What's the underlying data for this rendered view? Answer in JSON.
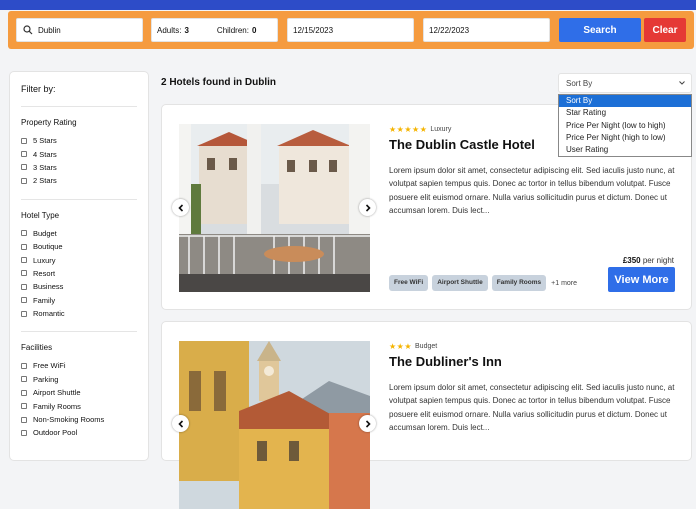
{
  "search": {
    "location": "Dublin",
    "adults_label": "Adults:",
    "adults_value": "3",
    "children_label": "Children:",
    "children_value": "0",
    "check_in": "12/15/2023",
    "check_out": "12/22/2023",
    "search_label": "Search",
    "clear_label": "Clear"
  },
  "filters": {
    "title": "Filter by:",
    "property_rating": {
      "heading": "Property Rating",
      "options": [
        "5 Stars",
        "4 Stars",
        "3 Stars",
        "2 Stars"
      ]
    },
    "hotel_type": {
      "heading": "Hotel Type",
      "options": [
        "Budget",
        "Boutique",
        "Luxury",
        "Resort",
        "Business",
        "Family",
        "Romantic"
      ]
    },
    "facilities": {
      "heading": "Facilities",
      "options": [
        "Free WiFi",
        "Parking",
        "Airport Shuttle",
        "Family Rooms",
        "Non-Smoking Rooms",
        "Outdoor Pool"
      ]
    }
  },
  "results": {
    "title": "2 Hotels found in Dublin"
  },
  "sort": {
    "current": "Sort By",
    "options": [
      "Sort By",
      "Star Rating",
      "Price Per Night (low to high)",
      "Price Per Night (high to low)",
      "User Rating"
    ]
  },
  "hotels": [
    {
      "stars": "★★★★★",
      "category": "Luxury",
      "name": "The Dublin Castle Hotel",
      "description": "Lorem ipsum dolor sit amet, consectetur adipiscing elit. Sed iaculis justo nunc, at volutpat sapien tempus quis. Donec ac tortor in tellus bibendum volutpat. Fusce posuere elit euismod ornare. Nulla varius sollicitudin purus et dictum. Donec ut accumsan lorem. Duis lect...",
      "amenities": [
        "Free WiFi",
        "Airport Shuttle",
        "Family Rooms"
      ],
      "more": "+1 more",
      "price": "£350",
      "price_suffix": "per night",
      "view_label": "View More"
    },
    {
      "stars": "★★★",
      "category": "Budget",
      "name": "The Dubliner's Inn",
      "description": "Lorem ipsum dolor sit amet, consectetur adipiscing elit. Sed iaculis justo nunc, at volutpat sapien tempus quis. Donec ac tortor in tellus bibendum volutpat. Fusce posuere elit euismod ornare. Nulla varius sollicitudin purus et dictum. Donec ut accumsan lorem. Duis lect..."
    }
  ],
  "colors": {
    "top_bar": "#2d4cc8",
    "search_bar": "#f59b3f",
    "primary": "#2f6ee8",
    "danger": "#e53935",
    "star": "#f5b400"
  }
}
